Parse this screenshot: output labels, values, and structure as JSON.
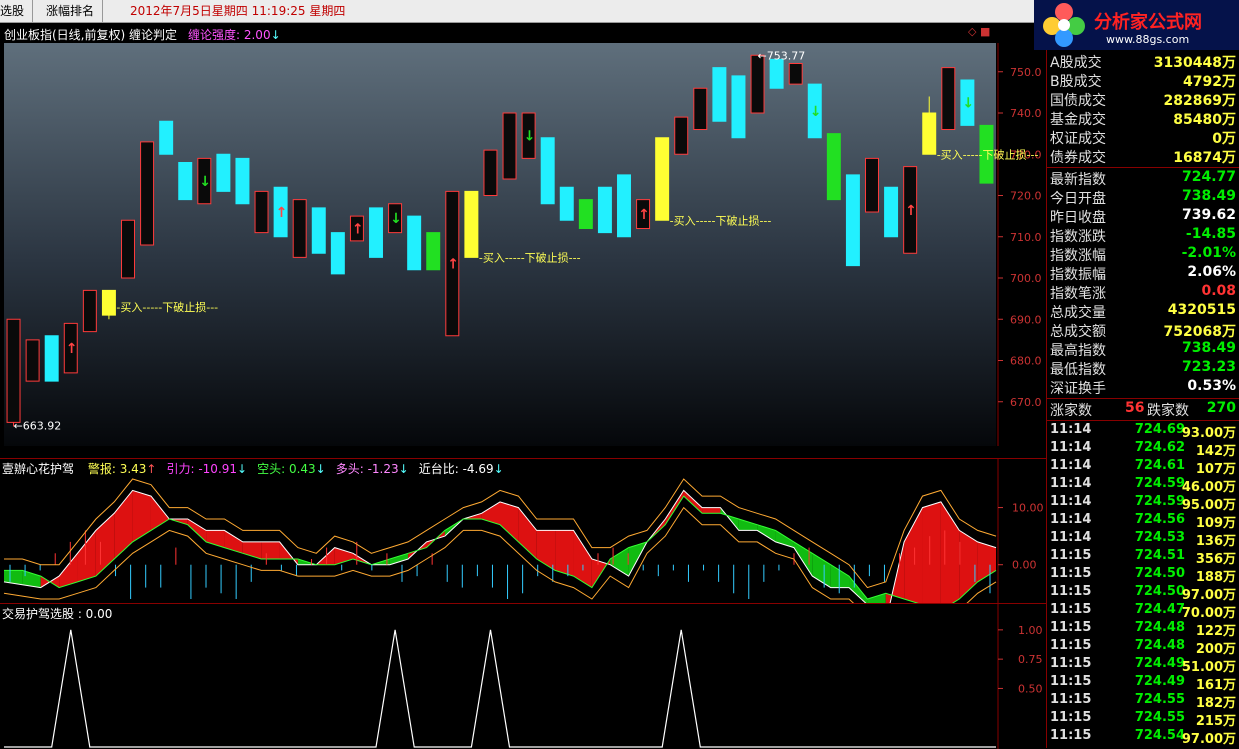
{
  "topbar": {
    "tab1": "选股",
    "tab2": "涨幅排名",
    "datetime": "2012年7月5日星期四   11:19:25 星期四"
  },
  "logo": {
    "title": "分析家公式网",
    "url": "www.88gs.com"
  },
  "main": {
    "caption": "创业板指(日线,前复权) 缠论判定",
    "strength_label": "缠论强度: 2.00",
    "high_marker": "753.77",
    "low_marker": "663.92",
    "buy_signal_text": "-买入-----下破止损---"
  },
  "chart_data": [
    {
      "type": "candlestick",
      "title": "创业板指(日线,前复权)",
      "ylim": [
        660,
        756
      ],
      "yticks": [
        "750.0",
        "740.0",
        "730.0",
        "720.0",
        "710.0",
        "700.0",
        "690.0",
        "680.0",
        "670.0"
      ],
      "candles": [
        {
          "o": 690,
          "c": 665,
          "h": 690,
          "l": 664,
          "color": "black"
        },
        {
          "o": 685,
          "c": 675,
          "h": 685,
          "l": 675,
          "color": "black"
        },
        {
          "o": 675,
          "c": 686,
          "h": 686,
          "l": 675,
          "color": "cyan"
        },
        {
          "o": 677,
          "c": 689,
          "h": 689,
          "l": 677,
          "color": "black"
        },
        {
          "o": 687,
          "c": 697,
          "h": 697,
          "l": 687,
          "color": "black"
        },
        {
          "o": 691,
          "c": 697,
          "h": 697,
          "l": 690,
          "color": "yellow"
        },
        {
          "o": 700,
          "c": 714,
          "h": 714,
          "l": 700,
          "color": "black"
        },
        {
          "o": 708,
          "c": 733,
          "h": 733,
          "l": 708,
          "color": "black"
        },
        {
          "o": 738,
          "c": 730,
          "h": 738,
          "l": 730,
          "color": "cyan"
        },
        {
          "o": 728,
          "c": 719,
          "h": 728,
          "l": 719,
          "color": "cyan"
        },
        {
          "o": 718,
          "c": 729,
          "h": 729,
          "l": 718,
          "color": "black"
        },
        {
          "o": 730,
          "c": 721,
          "h": 730,
          "l": 721,
          "color": "cyan"
        },
        {
          "o": 729,
          "c": 718,
          "h": 729,
          "l": 718,
          "color": "cyan"
        },
        {
          "o": 711,
          "c": 721,
          "h": 721,
          "l": 711,
          "color": "black"
        },
        {
          "o": 722,
          "c": 710,
          "h": 722,
          "l": 710,
          "color": "cyan"
        },
        {
          "o": 705,
          "c": 719,
          "h": 719,
          "l": 705,
          "color": "black"
        },
        {
          "o": 717,
          "c": 706,
          "h": 717,
          "l": 706,
          "color": "cyan"
        },
        {
          "o": 711,
          "c": 701,
          "h": 711,
          "l": 701,
          "color": "cyan"
        },
        {
          "o": 709,
          "c": 715,
          "h": 715,
          "l": 709,
          "color": "black"
        },
        {
          "o": 717,
          "c": 705,
          "h": 717,
          "l": 705,
          "color": "cyan"
        },
        {
          "o": 711,
          "c": 718,
          "h": 718,
          "l": 711,
          "color": "black"
        },
        {
          "o": 715,
          "c": 702,
          "h": 715,
          "l": 702,
          "color": "cyan"
        },
        {
          "o": 711,
          "c": 702,
          "h": 711,
          "l": 702,
          "color": "green"
        },
        {
          "o": 686,
          "c": 721,
          "h": 721,
          "l": 686,
          "color": "black"
        },
        {
          "o": 705,
          "c": 721,
          "h": 721,
          "l": 705,
          "color": "yellow"
        },
        {
          "o": 720,
          "c": 731,
          "h": 731,
          "l": 720,
          "color": "black"
        },
        {
          "o": 724,
          "c": 740,
          "h": 740,
          "l": 724,
          "color": "black"
        },
        {
          "o": 729,
          "c": 740,
          "h": 740,
          "l": 729,
          "color": "black"
        },
        {
          "o": 734,
          "c": 718,
          "h": 734,
          "l": 718,
          "color": "cyan"
        },
        {
          "o": 722,
          "c": 714,
          "h": 722,
          "l": 714,
          "color": "cyan"
        },
        {
          "o": 719,
          "c": 712,
          "h": 719,
          "l": 712,
          "color": "green"
        },
        {
          "o": 722,
          "c": 711,
          "h": 722,
          "l": 711,
          "color": "cyan"
        },
        {
          "o": 725,
          "c": 710,
          "h": 725,
          "l": 710,
          "color": "cyan"
        },
        {
          "o": 712,
          "c": 719,
          "h": 719,
          "l": 712,
          "color": "black"
        },
        {
          "o": 714,
          "c": 734,
          "h": 734,
          "l": 714,
          "color": "yellow"
        },
        {
          "o": 730,
          "c": 739,
          "h": 739,
          "l": 730,
          "color": "black"
        },
        {
          "o": 736,
          "c": 746,
          "h": 746,
          "l": 736,
          "color": "black"
        },
        {
          "o": 751,
          "c": 738,
          "h": 751,
          "l": 738,
          "color": "cyan"
        },
        {
          "o": 749,
          "c": 734,
          "h": 749,
          "l": 734,
          "color": "cyan"
        },
        {
          "o": 740,
          "c": 754,
          "h": 754,
          "l": 740,
          "color": "black"
        },
        {
          "o": 753,
          "c": 746,
          "h": 753,
          "l": 746,
          "color": "cyan"
        },
        {
          "o": 747,
          "c": 752,
          "h": 752,
          "l": 747,
          "color": "black"
        },
        {
          "o": 747,
          "c": 734,
          "h": 747,
          "l": 734,
          "color": "cyan"
        },
        {
          "o": 735,
          "c": 719,
          "h": 735,
          "l": 719,
          "color": "green"
        },
        {
          "o": 725,
          "c": 703,
          "h": 725,
          "l": 703,
          "color": "cyan"
        },
        {
          "o": 716,
          "c": 729,
          "h": 729,
          "l": 716,
          "color": "black"
        },
        {
          "o": 722,
          "c": 710,
          "h": 722,
          "l": 710,
          "color": "cyan"
        },
        {
          "o": 706,
          "c": 727,
          "h": 727,
          "l": 706,
          "color": "black"
        },
        {
          "o": 730,
          "c": 740,
          "h": 744,
          "l": 730,
          "color": "yellow"
        },
        {
          "o": 736,
          "c": 751,
          "h": 751,
          "l": 736,
          "color": "black"
        },
        {
          "o": 748,
          "c": 737,
          "h": 748,
          "l": 737,
          "color": "cyan"
        },
        {
          "o": 737,
          "c": 723,
          "h": 737,
          "l": 723,
          "color": "green"
        }
      ],
      "up_arrows": [
        3,
        14,
        18,
        23,
        33,
        47
      ],
      "down_arrows": [
        10,
        20,
        27,
        42,
        50
      ],
      "buy_signals": [
        {
          "i": 5,
          "price": 693
        },
        {
          "i": 24,
          "price": 705
        },
        {
          "i": 34,
          "price": 714
        },
        {
          "i": 48,
          "price": 730
        }
      ]
    },
    {
      "type": "area",
      "title": "壹辦心花护驾",
      "ylim": [
        -6,
        15
      ],
      "yticks": [
        "10.00",
        "0.00"
      ],
      "readouts": [
        {
          "label": "警报:",
          "value": "3.43",
          "arrow": "↑",
          "color": "#ffff55",
          "arrow_color": "#ff5555"
        },
        {
          "label": "引力:",
          "value": "-10.91",
          "arrow": "↓",
          "color": "#ff44ff",
          "arrow_color": "#55ffff"
        },
        {
          "label": "空头:",
          "value": "0.43",
          "arrow": "↓",
          "color": "#44ff44",
          "arrow_color": "#55ffff"
        },
        {
          "label": "多头:",
          "value": "-1.23",
          "arrow": "↓",
          "color": "#ff88ff",
          "arrow_color": "#55ffff"
        },
        {
          "label": "近台比:",
          "value": "-4.69",
          "arrow": "↓",
          "color": "#ffffff",
          "arrow_color": "#55ffff"
        }
      ],
      "line_a": [
        -3,
        -3.5,
        -4,
        -2,
        2,
        6,
        9,
        13,
        12,
        8,
        8,
        6,
        6,
        4,
        4,
        4,
        0,
        0,
        3,
        2,
        0,
        0,
        1,
        4,
        5,
        8,
        9,
        11,
        10,
        6,
        6,
        6,
        1,
        0,
        -2,
        4,
        8,
        13,
        10,
        10,
        6,
        6,
        4,
        3,
        -2,
        -4,
        -4,
        -7,
        -10,
        4,
        10,
        11,
        6,
        4,
        3
      ],
      "line_b": [
        -1,
        -1,
        -2,
        -4,
        -3,
        -2,
        1,
        4,
        6,
        8,
        7,
        4,
        3,
        2,
        1,
        1,
        1,
        0,
        0,
        1,
        0,
        1,
        2,
        3,
        6,
        8,
        8,
        7,
        4,
        1,
        -1,
        -2,
        -4,
        1,
        3,
        4,
        7,
        12,
        9,
        9,
        8,
        7,
        6,
        4,
        2,
        0,
        -2,
        -6,
        -5,
        -6,
        -7,
        -8,
        -6,
        -3,
        -1
      ],
      "bars": [
        -3,
        -2,
        -1,
        2,
        4,
        6,
        4,
        -2,
        -6,
        -4,
        -4,
        3,
        -6,
        -4,
        -5,
        -6,
        -3,
        2,
        -1,
        -2,
        1,
        3,
        -1,
        4,
        -1,
        2,
        -3,
        -2,
        2,
        -3,
        -4,
        -2,
        -4,
        -6,
        -5,
        -2,
        -3,
        -2,
        -1,
        2,
        3,
        2,
        -1,
        -2,
        -1,
        -3,
        -1,
        -3,
        -5,
        -6,
        -3,
        -1,
        2,
        3,
        -4,
        -5,
        -4,
        -2,
        -3,
        2,
        3,
        5,
        6,
        4,
        -3,
        -5
      ]
    },
    {
      "type": "line",
      "title": "交易护驾选股",
      "readout": "交易护驾选股 : 0.00",
      "ylim": [
        0,
        1.05
      ],
      "yticks": [
        "1.00",
        "0.75",
        "0.50"
      ],
      "spikes": [
        3,
        20,
        25,
        35
      ]
    }
  ],
  "right_panel": {
    "stats": [
      {
        "label": "A股成交",
        "value": "3130448万",
        "color": "#ffff44"
      },
      {
        "label": "B股成交",
        "value": "4792万",
        "color": "#ffff44"
      },
      {
        "label": "国债成交",
        "value": "282869万",
        "color": "#ffff44"
      },
      {
        "label": "基金成交",
        "value": "85480万",
        "color": "#ffff44"
      },
      {
        "label": "权证成交",
        "value": "0万",
        "color": "#ffff44"
      },
      {
        "label": "债券成交",
        "value": "16874万",
        "color": "#ffff44"
      }
    ],
    "index": [
      {
        "label": "最新指数",
        "value": "724.77",
        "color": "#00ee00"
      },
      {
        "label": "今日开盘",
        "value": "738.49",
        "color": "#00ee00"
      },
      {
        "label": "昨日收盘",
        "value": "739.62",
        "color": "#ffffff"
      },
      {
        "label": "指数涨跌",
        "value": "-14.85",
        "color": "#00ee00"
      },
      {
        "label": "指数涨幅",
        "value": "-2.01%",
        "color": "#00ee00"
      },
      {
        "label": "指数振幅",
        "value": "2.06%",
        "color": "#ffffff"
      },
      {
        "label": "指数笔涨",
        "value": "0.08",
        "color": "#ff3333"
      },
      {
        "label": "总成交量",
        "value": "4320515",
        "color": "#ffff44"
      },
      {
        "label": "总成交额",
        "value": "752068万",
        "color": "#ffff44"
      },
      {
        "label": "最高指数",
        "value": "738.49",
        "color": "#00ee00"
      },
      {
        "label": "最低指数",
        "value": "723.23",
        "color": "#00ee00"
      },
      {
        "label": "深证换手",
        "value": "0.53%",
        "color": "#ffffff"
      }
    ],
    "breadth": {
      "up_label": "涨家数",
      "up_value": "56",
      "down_label": "跌家数",
      "down_value": "270"
    },
    "ticks": [
      {
        "t": "11:14",
        "p": "724.69",
        "v": "93.00万"
      },
      {
        "t": "11:14",
        "p": "724.62",
        "v": "142万"
      },
      {
        "t": "11:14",
        "p": "724.61",
        "v": "107万"
      },
      {
        "t": "11:14",
        "p": "724.59",
        "v": "46.00万"
      },
      {
        "t": "11:14",
        "p": "724.59",
        "v": "95.00万"
      },
      {
        "t": "11:14",
        "p": "724.56",
        "v": "109万"
      },
      {
        "t": "11:14",
        "p": "724.53",
        "v": "136万"
      },
      {
        "t": "11:15",
        "p": "724.51",
        "v": "356万"
      },
      {
        "t": "11:15",
        "p": "724.50",
        "v": "188万"
      },
      {
        "t": "11:15",
        "p": "724.50",
        "v": "97.00万"
      },
      {
        "t": "11:15",
        "p": "724.47",
        "v": "70.00万"
      },
      {
        "t": "11:15",
        "p": "724.48",
        "v": "122万"
      },
      {
        "t": "11:15",
        "p": "724.48",
        "v": "200万"
      },
      {
        "t": "11:15",
        "p": "724.49",
        "v": "51.00万"
      },
      {
        "t": "11:15",
        "p": "724.49",
        "v": "161万"
      },
      {
        "t": "11:15",
        "p": "724.55",
        "v": "182万"
      },
      {
        "t": "11:15",
        "p": "724.55",
        "v": "215万"
      },
      {
        "t": "11:15",
        "p": "724.54",
        "v": "97.00万"
      }
    ]
  }
}
